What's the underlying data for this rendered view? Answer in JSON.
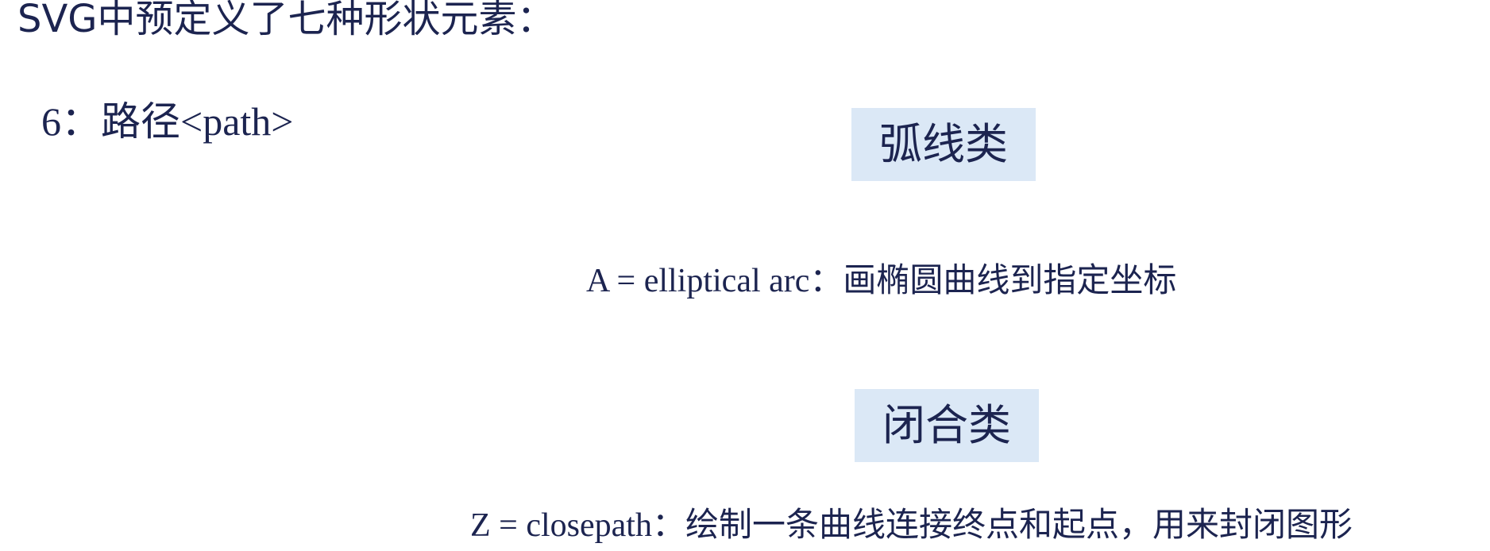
{
  "slide": {
    "title": "SVG中预定义了七种形状元素：",
    "subtitle": "6：路径<path>",
    "sections": [
      {
        "category_label": "弧线类",
        "description": "A = elliptical arc：画椭圆曲线到指定坐标"
      },
      {
        "category_label": "闭合类",
        "description": "Z = closepath：绘制一条曲线连接终点和起点，用来封闭图形"
      }
    ]
  },
  "colors": {
    "text": "#1c2450",
    "box_background": "#dbe8f6",
    "background": "#ffffff"
  }
}
